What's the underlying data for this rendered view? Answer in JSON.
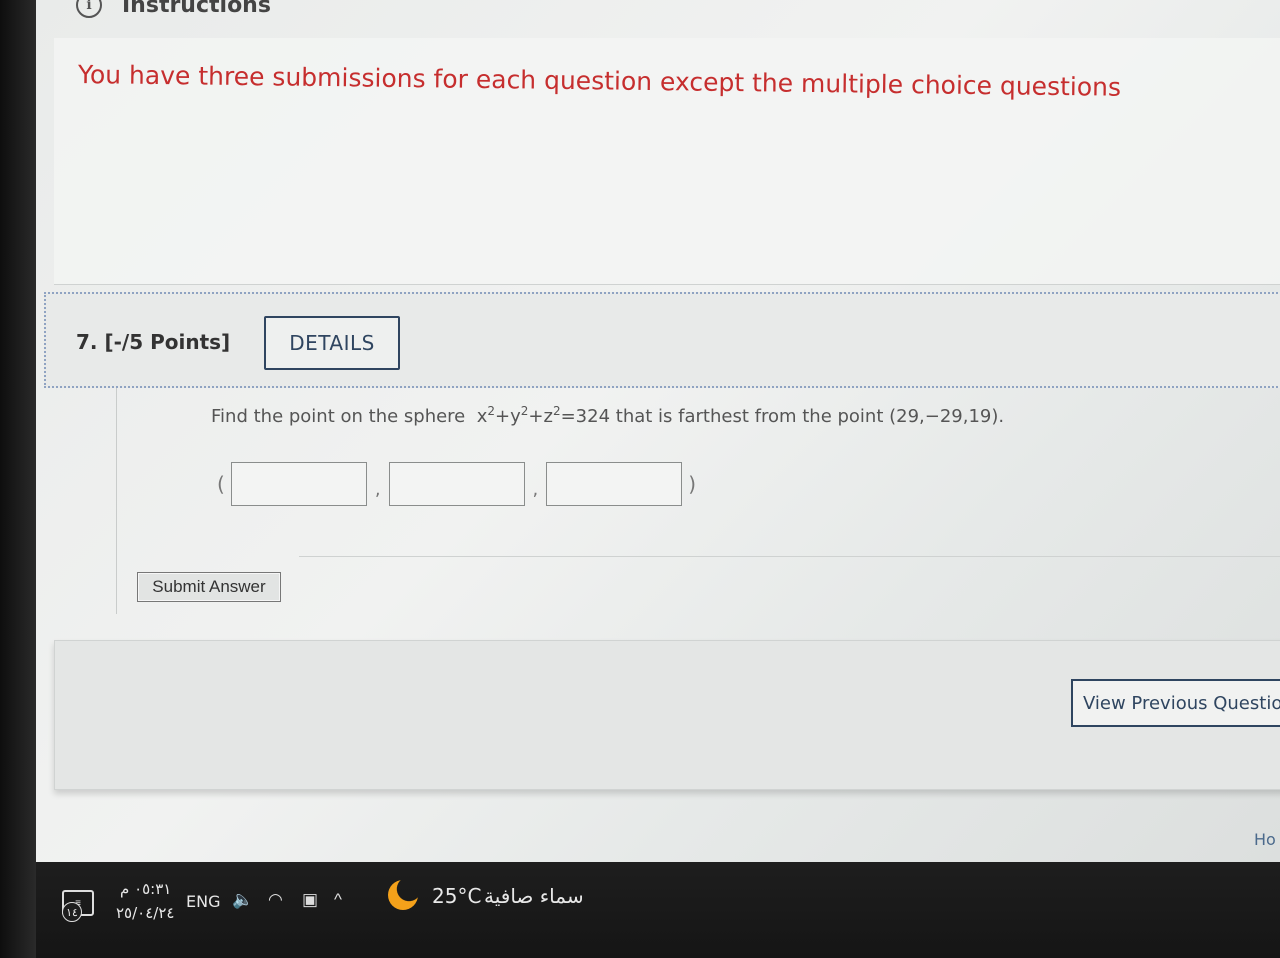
{
  "instructions": {
    "title": "Instructions",
    "message": "You have three submissions for each question except the multiple choice questions"
  },
  "question": {
    "number_points": "7.  [-/5 Points]",
    "details_label": "DETAILS",
    "text_prefix": "Find the point on the sphere",
    "text_suffix": "that is farthest from the point (29,−29,19).",
    "equation": {
      "x": "x",
      "y": "y",
      "z": "z",
      "exp": "2",
      "rhs": "=324"
    },
    "answer_open": "(",
    "answer_close": ")",
    "answer_sep": ",",
    "answers": [
      "",
      "",
      ""
    ],
    "submit_label": "Submit Answer"
  },
  "navigation": {
    "prev_label": "View Previous Question",
    "home_label": "Ho"
  },
  "taskbar": {
    "time": "٠٥:٣١ م",
    "date": "٢٥/٠٤/٢٤",
    "language": "ENG",
    "day_badge": "١٤",
    "weather_temp": "25°C",
    "weather_desc": "سماء صافية",
    "icons": [
      "notification-icon",
      "volume-icon",
      "wifi-icon",
      "meet-now-icon",
      "chevron-up-icon",
      "weather-moon-icon"
    ]
  }
}
